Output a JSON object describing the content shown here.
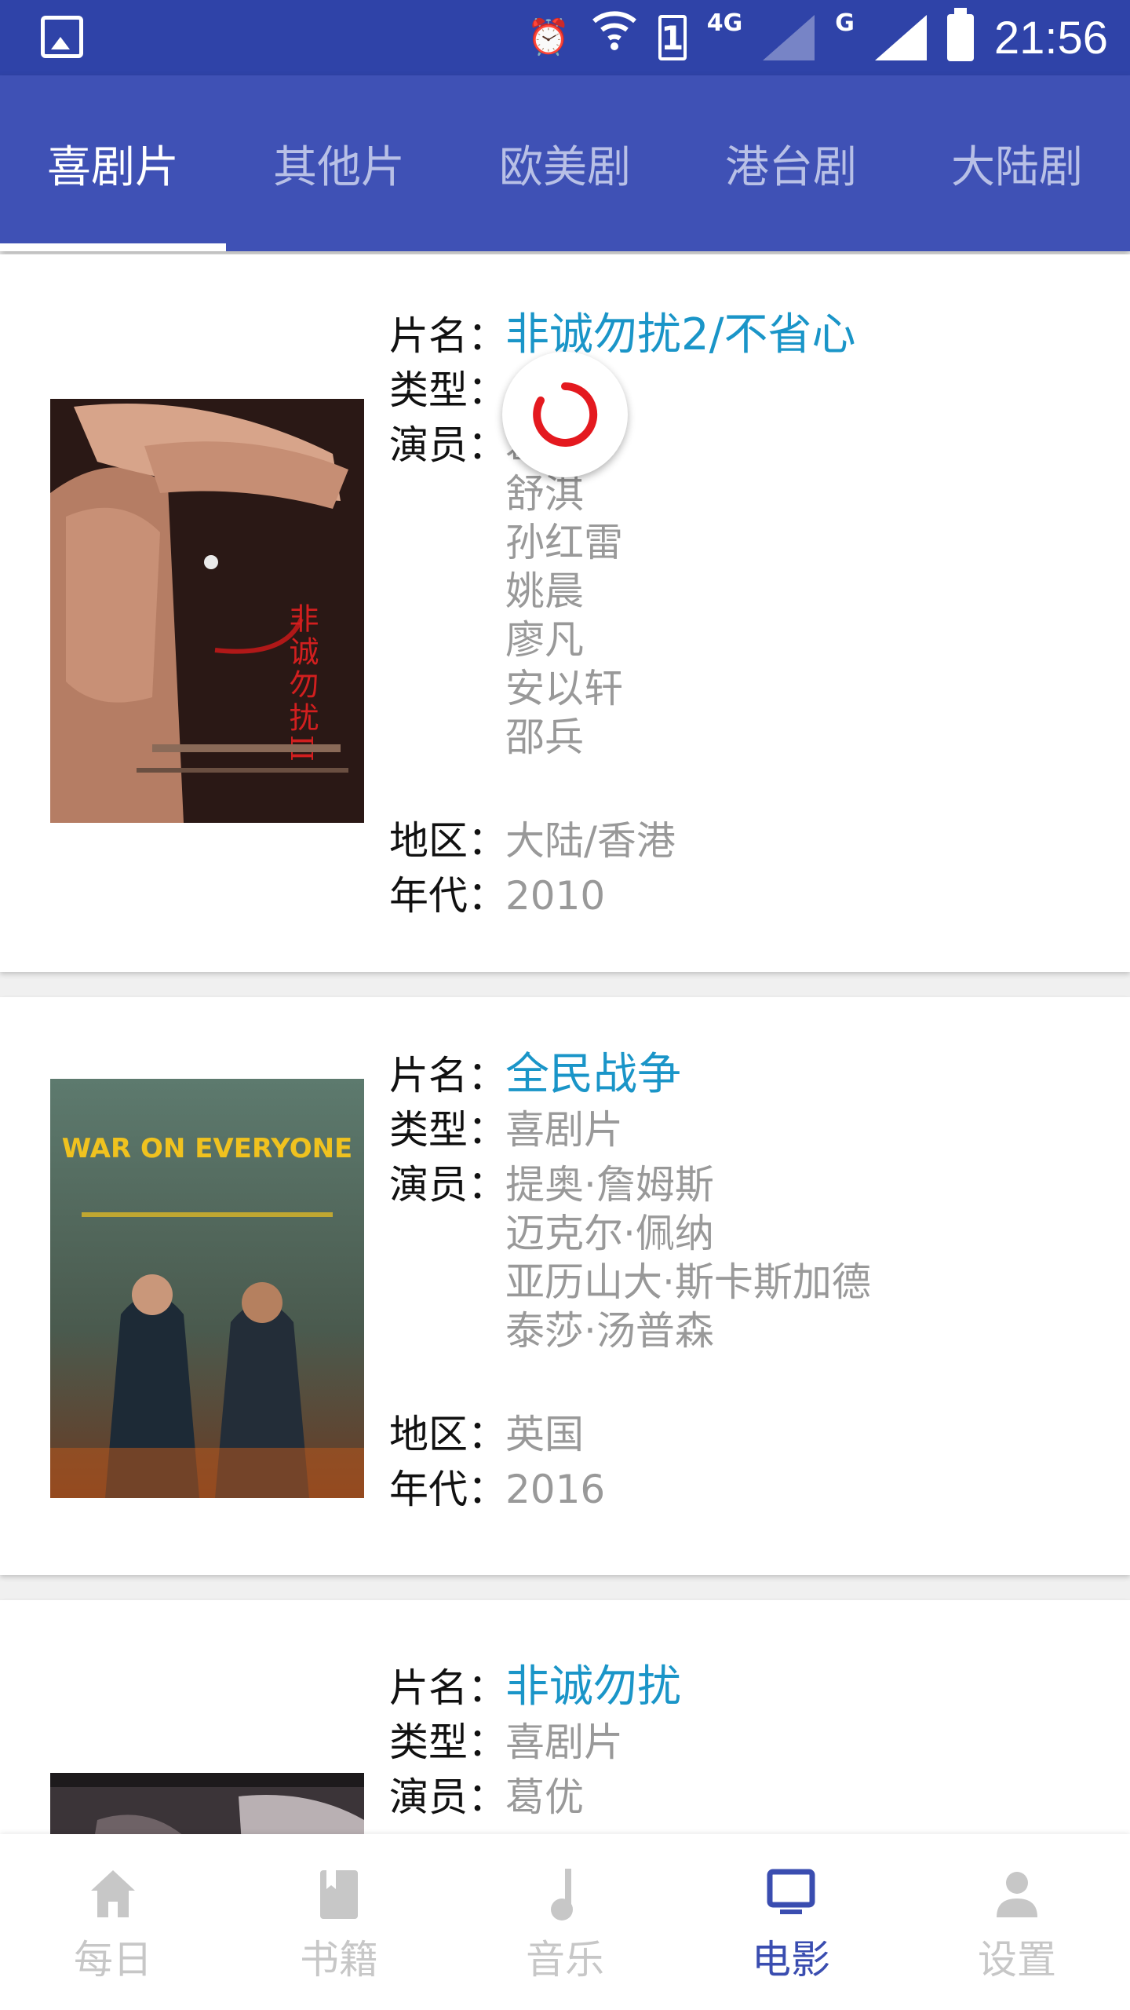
{
  "status_bar": {
    "network_label": "4G",
    "sim_badge": "1",
    "secondary_network": "G",
    "time": "21:56"
  },
  "tabs": [
    {
      "label": "喜剧片",
      "active": true
    },
    {
      "label": "其他片",
      "active": false
    },
    {
      "label": "欧美剧",
      "active": false
    },
    {
      "label": "港台剧",
      "active": false
    },
    {
      "label": "大陆剧",
      "active": false
    }
  ],
  "labels": {
    "title": "片名：",
    "genre": "类型：",
    "cast": "演员：",
    "region": "地区：",
    "year": "年代："
  },
  "movies": [
    {
      "title": "非诚勿扰2/不省心",
      "genre": "",
      "cast": [
        "葛优",
        "舒淇",
        "孙红雷",
        "姚晨",
        "廖凡",
        "安以轩",
        "邵兵"
      ],
      "region": "大陆/香港",
      "year": "2010",
      "poster_text": "非诚勿扰II"
    },
    {
      "title": "全民战争",
      "genre": "喜剧片",
      "cast": [
        "提奥·詹姆斯",
        "迈克尔·佩纳",
        "亚历山大·斯卡斯加德",
        "泰莎·汤普森"
      ],
      "region": "英国",
      "year": "2016",
      "poster_text": "WAR ON EVERYONE"
    },
    {
      "title": "非诚勿扰",
      "genre": "喜剧片",
      "cast": [
        "葛优"
      ]
    }
  ],
  "bottom_nav": [
    {
      "label": "每日",
      "icon": "home-icon",
      "active": false
    },
    {
      "label": "书籍",
      "icon": "book-icon",
      "active": false
    },
    {
      "label": "音乐",
      "icon": "music-note-icon",
      "active": false
    },
    {
      "label": "电影",
      "icon": "tv-icon",
      "active": true
    },
    {
      "label": "设置",
      "icon": "person-icon",
      "active": false
    }
  ],
  "colors": {
    "primary": "#3f51b5",
    "status_bar": "#2f43a8",
    "title_link": "#1a95c8",
    "nav_active": "#3a4db0",
    "spinner": "#e4191f"
  }
}
